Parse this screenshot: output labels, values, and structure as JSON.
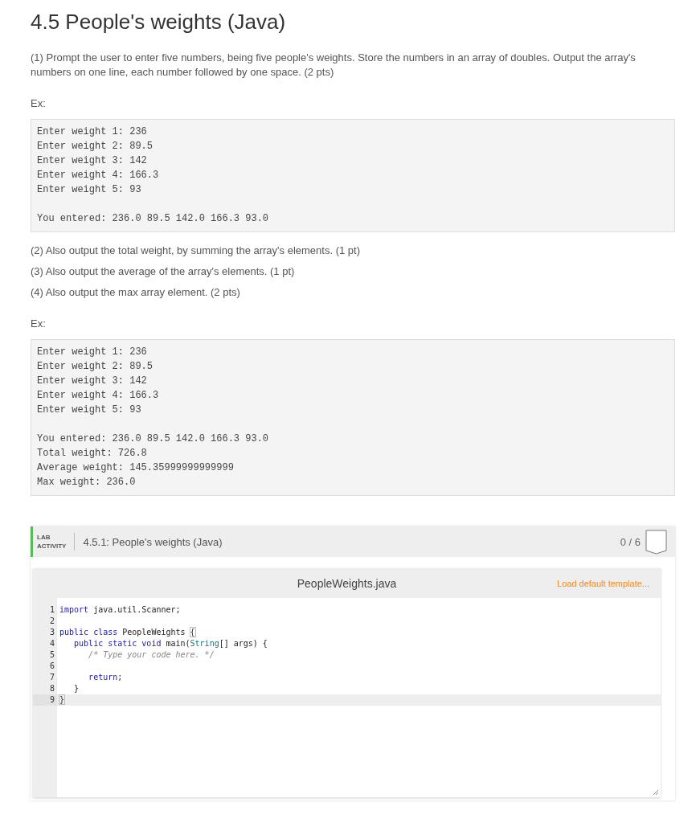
{
  "title": "4.5 People's weights (Java)",
  "part1": "(1) Prompt the user to enter five numbers, being five people's weights. Store the numbers in an array of doubles. Output the array's numbers on one line, each number followed by one space. (2 pts)",
  "example1": {
    "label": "Ex:",
    "groups": [
      [
        "Enter weight 1: 236",
        "Enter weight 2: 89.5",
        "Enter weight 3: 142",
        "Enter weight 4: 166.3",
        "Enter weight 5: 93"
      ],
      [
        "You entered: 236.0 89.5 142.0 166.3 93.0"
      ]
    ]
  },
  "parts": [
    "(2) Also output the total weight, by summing the array's elements. (1 pt)",
    "(3) Also output the average of the array's elements. (1 pt)",
    "(4) Also output the max array element. (2 pts)"
  ],
  "example2": {
    "label": "Ex:",
    "groups": [
      [
        "Enter weight 1: 236",
        "Enter weight 2: 89.5",
        "Enter weight 3: 142",
        "Enter weight 4: 166.3",
        "Enter weight 5: 93"
      ],
      [
        "You entered: 236.0 89.5 142.0 166.3 93.0",
        "Total weight: 726.8",
        "Average weight: 145.35999999999999",
        "Max weight: 236.0"
      ]
    ]
  },
  "lab": {
    "badge_line1": "LAB",
    "badge_line2": "ACTIVITY",
    "title": "4.5.1: People's weights (Java)",
    "score": "0 / 6",
    "editor": {
      "filename": "PeopleWeights.java",
      "load_link": "Load default template...",
      "lines": [
        {
          "number": "1",
          "selected": false,
          "tokens": [
            {
              "kind": "keyword",
              "text": "import"
            },
            {
              "kind": "plain",
              "text": " java.util.Scanner;"
            }
          ]
        },
        {
          "number": "2",
          "selected": false
        },
        {
          "number": "3",
          "selected": false,
          "tokens": [
            {
              "kind": "keyword",
              "text": "public class"
            },
            {
              "kind": "plain",
              "text": " PeopleWeights "
            },
            {
              "kind": "bracket",
              "text": "{"
            }
          ]
        },
        {
          "number": "4",
          "selected": false,
          "tokens": [
            {
              "kind": "keyword",
              "text": "   public static void"
            },
            {
              "kind": "plain",
              "text": " main("
            },
            {
              "kind": "type",
              "text": "String"
            },
            {
              "kind": "plain",
              "text": "[] args) {"
            }
          ]
        },
        {
          "number": "5",
          "selected": false,
          "tokens": [
            {
              "kind": "comment",
              "text": "      /* Type your code here. */"
            }
          ]
        },
        {
          "number": "6",
          "selected": false
        },
        {
          "number": "7",
          "selected": false,
          "tokens": [
            {
              "kind": "keyword",
              "text": "      return"
            },
            {
              "kind": "plain",
              "text": ";"
            }
          ]
        },
        {
          "number": "8",
          "selected": false,
          "tokens": [
            {
              "kind": "plain",
              "text": "   }"
            }
          ]
        },
        {
          "number": "9",
          "selected": true,
          "tokens": [
            {
              "kind": "bracket",
              "text": "}"
            }
          ]
        }
      ]
    }
  }
}
